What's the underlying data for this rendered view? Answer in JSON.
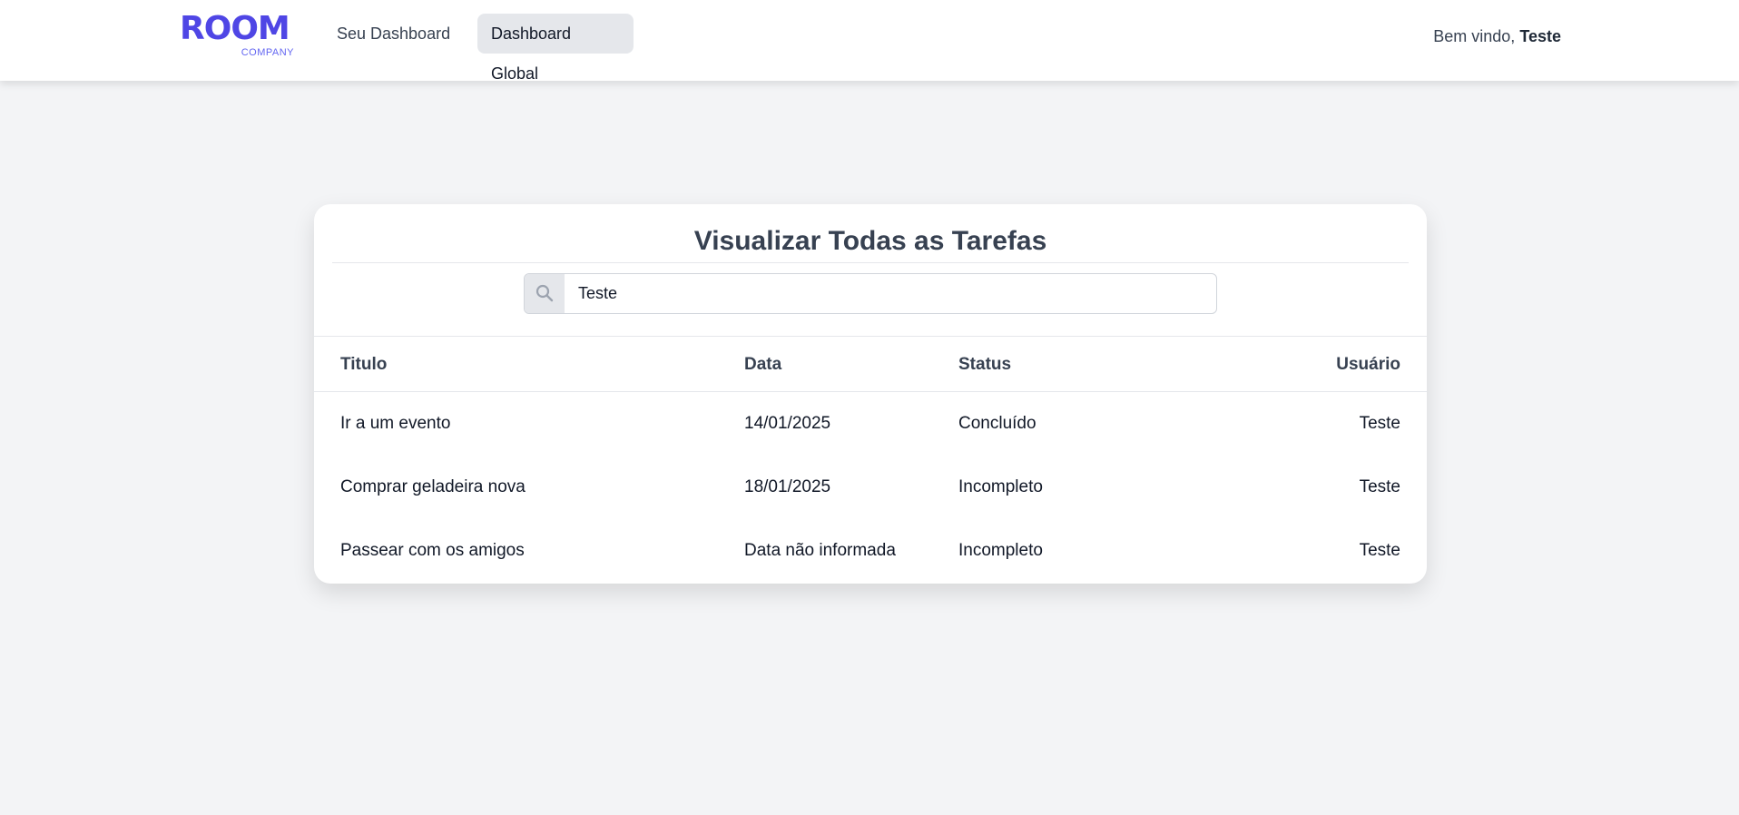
{
  "header": {
    "logo": {
      "word": "ROOM",
      "sub": "COMPANY",
      "color": "#4f46e5"
    },
    "nav": [
      {
        "label": "Seu Dashboard",
        "active": false
      },
      {
        "label": "Dashboard Global",
        "active": true
      }
    ],
    "welcome_prefix": "Bem vindo,",
    "username": "Teste"
  },
  "main": {
    "title": "Visualizar Todas as Tarefas",
    "search": {
      "value": "Teste",
      "icon": "search-icon"
    },
    "table": {
      "columns": [
        "Titulo",
        "Data",
        "Status",
        "Usuário"
      ],
      "rows": [
        [
          "Ir a um evento",
          "14/01/2025",
          "Concluído",
          "Teste"
        ],
        [
          "Comprar geladeira nova",
          "18/01/2025",
          "Incompleto",
          "Teste"
        ],
        [
          "Passear com os amigos",
          "Data não informada",
          "Incompleto",
          "Teste"
        ]
      ]
    }
  }
}
